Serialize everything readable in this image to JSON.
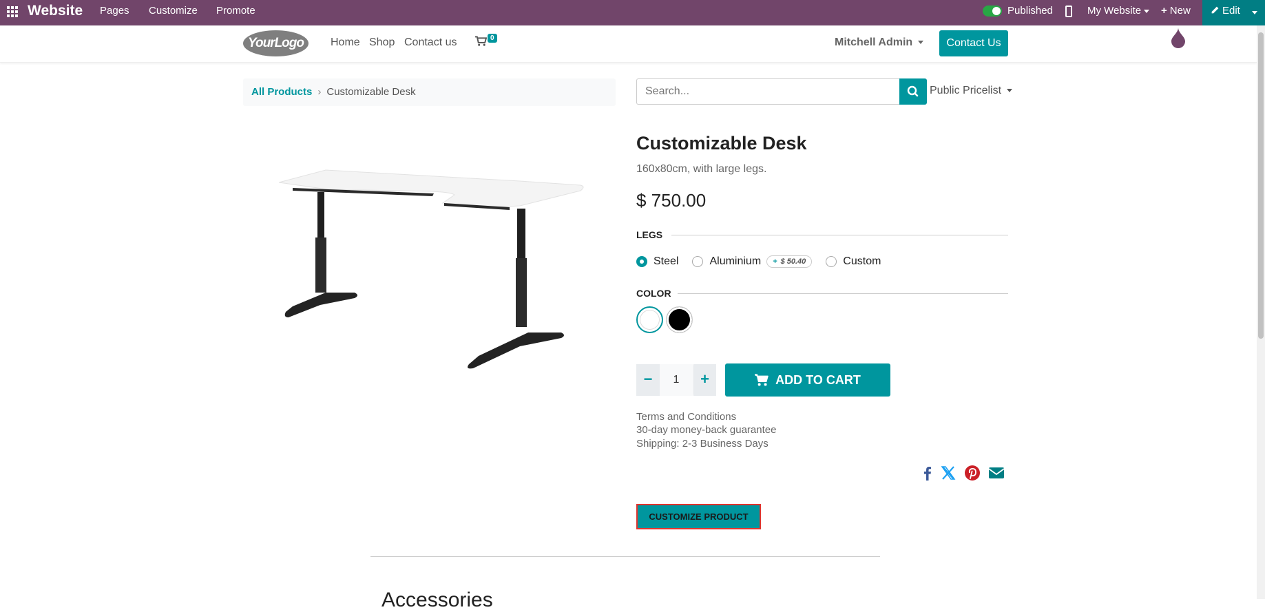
{
  "adminbar": {
    "brand": "Website",
    "menus": [
      "Pages",
      "Customize",
      "Promote"
    ],
    "published_label": "Published",
    "my_website": "My Website",
    "new_label": "New",
    "edit_label": "Edit"
  },
  "header": {
    "logo_text": "YourLogo",
    "nav": [
      "Home",
      "Shop",
      "Contact us"
    ],
    "cart_count": "0",
    "user": "Mitchell Admin",
    "contact_button": "Contact Us"
  },
  "breadcrumb": {
    "parent": "All Products",
    "current": "Customizable Desk"
  },
  "search": {
    "placeholder": "Search...",
    "pricelist": "Public Pricelist"
  },
  "product": {
    "title": "Customizable Desk",
    "description": "160x80cm, with large legs.",
    "price": "$ 750.00",
    "legs_label": "LEGS",
    "legs_options": [
      {
        "label": "Steel",
        "selected": true
      },
      {
        "label": "Aluminium",
        "selected": false,
        "extra": "$ 50.40"
      },
      {
        "label": "Custom",
        "selected": false
      }
    ],
    "extra_prefix": "+",
    "color_label": "COLOR",
    "colors": [
      {
        "name": "White",
        "hex": "#ffffff",
        "selected": true
      },
      {
        "name": "Black",
        "hex": "#000000",
        "selected": false
      }
    ],
    "quantity": "1",
    "add_to_cart": "ADD TO CART",
    "terms": [
      "Terms and Conditions",
      "30-day money-back guarantee",
      "Shipping: 2-3 Business Days"
    ],
    "customize_button": "CUSTOMIZE PRODUCT",
    "share_icons": [
      "facebook-icon",
      "x-twitter-icon",
      "pinterest-icon",
      "email-icon"
    ]
  },
  "section_heading": "Accessories",
  "colors": {
    "admin_bar": "#71456a",
    "primary": "#00969e",
    "edit_bg": "#017e84"
  }
}
